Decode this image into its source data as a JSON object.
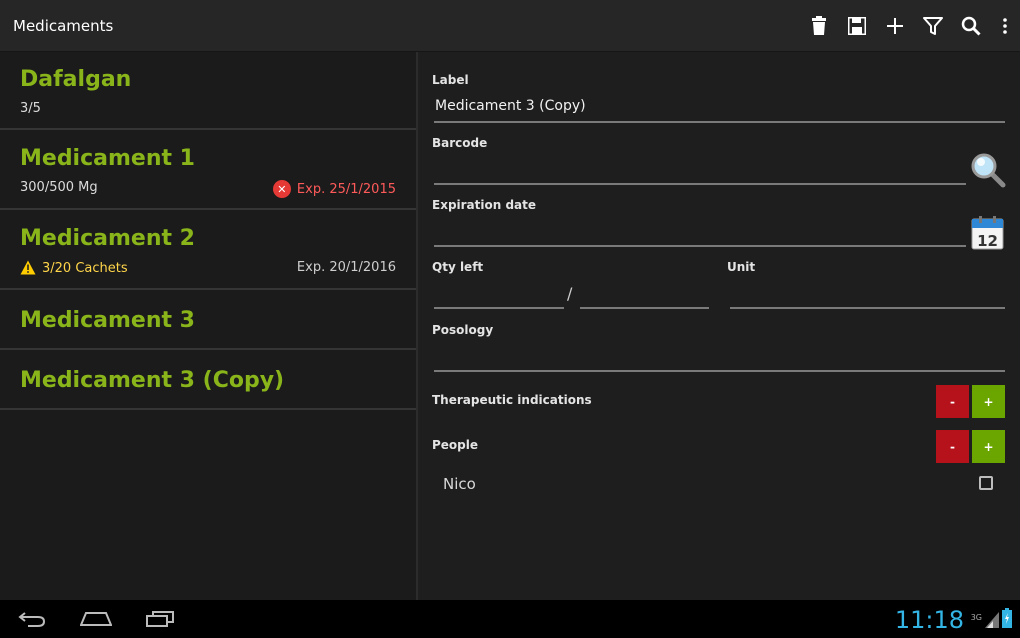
{
  "actionbar": {
    "title": "Medicaments",
    "actions": [
      "delete-icon",
      "save-icon",
      "add-icon",
      "filter-icon",
      "search-icon",
      "overflow-icon"
    ]
  },
  "list": {
    "items": [
      {
        "name": "Dafalgan",
        "sub": "3/5"
      },
      {
        "name": "Medicament 1",
        "sub": "300/500 Mg",
        "expiry": "Exp. 25/1/2015",
        "expiry_status": "expired"
      },
      {
        "name": "Medicament 2",
        "sub": "3/20 Cachets",
        "expiry": "Exp. 20/1/2016",
        "qty_status": "warning"
      },
      {
        "name": "Medicament 3"
      },
      {
        "name": "Medicament 3 (Copy)"
      }
    ]
  },
  "form": {
    "label_title": "Label",
    "label_value": "Medicament 3 (Copy)",
    "barcode_title": "Barcode",
    "barcode_value": "",
    "expiration_title": "Expiration date",
    "expiration_value": "",
    "calendar_day": "12",
    "qty_title": "Qty left",
    "qty_separator": "/",
    "qty_left_value": "",
    "qty_total_value": "",
    "unit_title": "Unit",
    "unit_value": "",
    "posology_title": "Posology",
    "posology_value": "",
    "therapeutic_title": "Therapeutic indications",
    "people_title": "People",
    "minus_label": "-",
    "plus_label": "+",
    "people": [
      {
        "name": "Nico",
        "checked": false
      }
    ]
  },
  "statusbar": {
    "time": "11:18",
    "network": "3G"
  },
  "colors": {
    "accent_green": "#8ab51a",
    "clock_blue": "#33b5e5",
    "minus_red": "#b5121b",
    "plus_green": "#6aa500",
    "expired_red": "#ff5a5a"
  }
}
